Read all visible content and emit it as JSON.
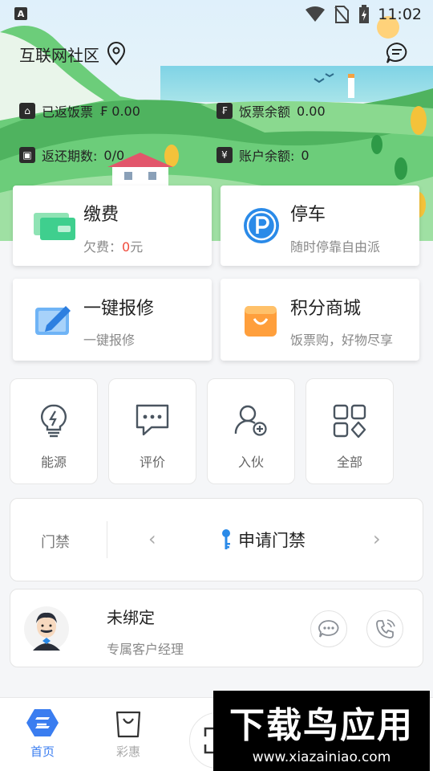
{
  "status": {
    "time": "11:02",
    "app_icon": "A"
  },
  "header": {
    "community": "互联网社区"
  },
  "stats": {
    "returned_ticket_label": "已返饭票",
    "returned_ticket_value": "₣ 0.00",
    "ticket_balance_label": "饭票余额",
    "ticket_balance_value": "0.00",
    "periods_label": "返还期数:",
    "periods_value": "0/0",
    "account_balance_label": "账户余额:",
    "account_balance_value": "0",
    "ticket_icon_char": "₣",
    "yen_icon_char": "¥"
  },
  "cards": {
    "pay": {
      "title": "缴费",
      "sub_prefix": "欠费：",
      "sub_amount": "0",
      "sub_suffix": "元"
    },
    "parking": {
      "title": "停车",
      "sub": "随时停靠自由派"
    },
    "repair": {
      "title": "一键报修",
      "sub": "一键报修"
    },
    "mall": {
      "title": "积分商城",
      "sub": "饭票购，好物尽享"
    }
  },
  "quick": [
    "能源",
    "评价",
    "入伙",
    "全部"
  ],
  "access": {
    "label": "门禁",
    "action": "申请门禁",
    "prev": "‹",
    "next": "›"
  },
  "manager": {
    "name": "未绑定",
    "role": "专属客户经理"
  },
  "nav": {
    "home": "首页",
    "deals": "彩惠"
  },
  "watermark": {
    "big": "下载鸟应用",
    "small": "www.xiazainiao.com"
  },
  "colors": {
    "accent": "#3a7df0",
    "debt": "#f04b3c",
    "grass": "#5fbf6a"
  }
}
